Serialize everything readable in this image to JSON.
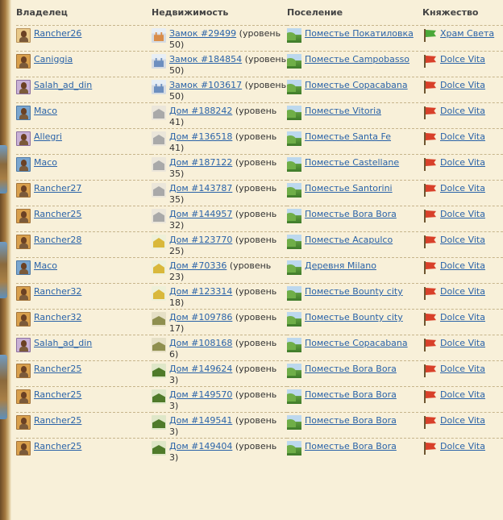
{
  "headers": {
    "owner": "Владелец",
    "property": "Недвижимость",
    "settlement": "Поселение",
    "principality": "Княжество"
  },
  "rows": [
    {
      "owner": "Rancher26",
      "owner_avatar": "avatar-light",
      "building_icon": "castle-orange-icon",
      "property": "Замок #29499",
      "level": "(уровень 50)",
      "settlement": "Поместье Покатиловка",
      "principality": "Храм Света",
      "flag": "green-flag-icon"
    },
    {
      "owner": "Caniggia",
      "owner_avatar": "avatar",
      "building_icon": "castle-icon",
      "property": "Замок #184854",
      "level": "(уровень 50)",
      "settlement": "Поместье Campobasso",
      "principality": "Dolce Vita",
      "flag": "red-flag-icon"
    },
    {
      "owner": "Salah_ad_din",
      "owner_avatar": "avatar-lilac",
      "building_icon": "castle-icon",
      "property": "Замок #103617",
      "level": "(уровень 50)",
      "settlement": "Поместье Copacabana",
      "principality": "Dolce Vita",
      "flag": "red-flag-icon"
    },
    {
      "owner": "Maco",
      "owner_avatar": "avatar-blue",
      "building_icon": "manor-icon",
      "property": "Дом #188242",
      "level": "(уровень 41)",
      "settlement": "Поместье Vitoria",
      "principality": "Dolce Vita",
      "flag": "red-flag-icon"
    },
    {
      "owner": "Allegri",
      "owner_avatar": "avatar-lilac",
      "building_icon": "manor-icon",
      "property": "Дом #136518",
      "level": "(уровень 41)",
      "settlement": "Поместье Santa Fe",
      "principality": "Dolce Vita",
      "flag": "red-flag-icon"
    },
    {
      "owner": "Maco",
      "owner_avatar": "avatar-blue",
      "building_icon": "manor-icon",
      "property": "Дом #187122",
      "level": "(уровень 35)",
      "settlement": "Поместье Castellane",
      "principality": "Dolce Vita",
      "flag": "red-flag-icon"
    },
    {
      "owner": "Rancher27",
      "owner_avatar": "avatar",
      "building_icon": "manor-icon",
      "property": "Дом #143787",
      "level": "(уровень 35)",
      "settlement": "Поместье Santorini",
      "principality": "Dolce Vita",
      "flag": "red-flag-icon"
    },
    {
      "owner": "Rancher25",
      "owner_avatar": "avatar",
      "building_icon": "manor-icon",
      "property": "Дом #144957",
      "level": "(уровень 32)",
      "settlement": "Поместье Bora Bora",
      "principality": "Dolce Vita",
      "flag": "red-flag-icon"
    },
    {
      "owner": "Rancher28",
      "owner_avatar": "avatar",
      "building_icon": "house-icon",
      "property": "Дом #123770",
      "level": "(уровень 25)",
      "settlement": "Поместье Acapulco",
      "principality": "Dolce Vita",
      "flag": "red-flag-icon"
    },
    {
      "owner": "Maco",
      "owner_avatar": "avatar-blue",
      "building_icon": "house-icon",
      "property": "Дом #70336",
      "level": "(уровень 23)",
      "settlement": "Деревня Milano",
      "principality": "Dolce Vita",
      "flag": "red-flag-icon"
    },
    {
      "owner": "Rancher32",
      "owner_avatar": "avatar",
      "building_icon": "house-icon",
      "property": "Дом #123314",
      "level": "(уровень 18)",
      "settlement": "Поместье Bounty city",
      "principality": "Dolce Vita",
      "flag": "red-flag-icon"
    },
    {
      "owner": "Rancher32",
      "owner_avatar": "avatar",
      "building_icon": "cottage-icon",
      "property": "Дом #109786",
      "level": "(уровень 17)",
      "settlement": "Поместье Bounty city",
      "principality": "Dolce Vita",
      "flag": "red-flag-icon"
    },
    {
      "owner": "Salah_ad_din",
      "owner_avatar": "avatar-lilac",
      "building_icon": "cottage-icon",
      "property": "Дом #108168",
      "level": "(уровень 6)",
      "settlement": "Поместье Copacabana",
      "principality": "Dolce Vita",
      "flag": "red-flag-icon"
    },
    {
      "owner": "Rancher25",
      "owner_avatar": "avatar",
      "building_icon": "hut-icon",
      "property": "Дом #149624",
      "level": "(уровень 3)",
      "settlement": "Поместье Bora Bora",
      "principality": "Dolce Vita",
      "flag": "red-flag-icon"
    },
    {
      "owner": "Rancher25",
      "owner_avatar": "avatar",
      "building_icon": "hut-icon",
      "property": "Дом #149570",
      "level": "(уровень 3)",
      "settlement": "Поместье Bora Bora",
      "principality": "Dolce Vita",
      "flag": "red-flag-icon"
    },
    {
      "owner": "Rancher25",
      "owner_avatar": "avatar",
      "building_icon": "hut-icon",
      "property": "Дом #149541",
      "level": "(уровень 3)",
      "settlement": "Поместье Bora Bora",
      "principality": "Dolce Vita",
      "flag": "red-flag-icon"
    },
    {
      "owner": "Rancher25",
      "owner_avatar": "avatar",
      "building_icon": "hut-icon",
      "property": "Дом #149404",
      "level": "(уровень 3)",
      "settlement": "Поместье Bora Bora",
      "principality": "Dolce Vita",
      "flag": "red-flag-icon"
    }
  ],
  "colors": {
    "link": "#2a63a8",
    "background": "#f8f0d9",
    "divider": "#c7b58c"
  }
}
